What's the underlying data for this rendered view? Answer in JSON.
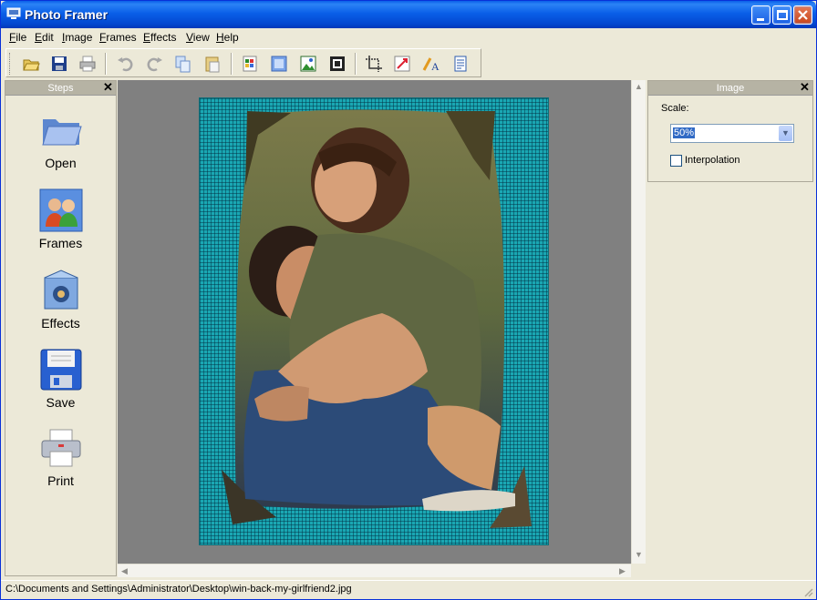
{
  "window": {
    "title": "Photo Framer",
    "accent": "#0a5fe8"
  },
  "menu": [
    "File",
    "Edit",
    "Image",
    "Frames",
    "Effects",
    "View",
    "Help"
  ],
  "toolbar": {
    "icons": [
      "open-icon",
      "save-icon",
      "print-icon",
      "undo-icon",
      "redo-icon",
      "copy-icon",
      "paste-icon",
      "color-icon",
      "frame-icon",
      "image-icon",
      "border-icon",
      "crop-icon",
      "resize-icon",
      "text-icon",
      "page-icon"
    ]
  },
  "steps": {
    "title": "Steps",
    "items": [
      {
        "label": "Open",
        "icon": "folder-icon"
      },
      {
        "label": "Frames",
        "icon": "people-icon"
      },
      {
        "label": "Effects",
        "icon": "effects-box-icon"
      },
      {
        "label": "Save",
        "icon": "floppy-icon"
      },
      {
        "label": "Print",
        "icon": "printer-icon"
      }
    ]
  },
  "image_panel": {
    "title": "Image",
    "scale_label": "Scale:",
    "scale_value": "50%",
    "interpolation_label": "Interpolation",
    "interpolation_checked": false
  },
  "status": {
    "path": "C:\\Documents and Settings\\Administrator\\Desktop\\win-back-my-girlfriend2.jpg"
  }
}
